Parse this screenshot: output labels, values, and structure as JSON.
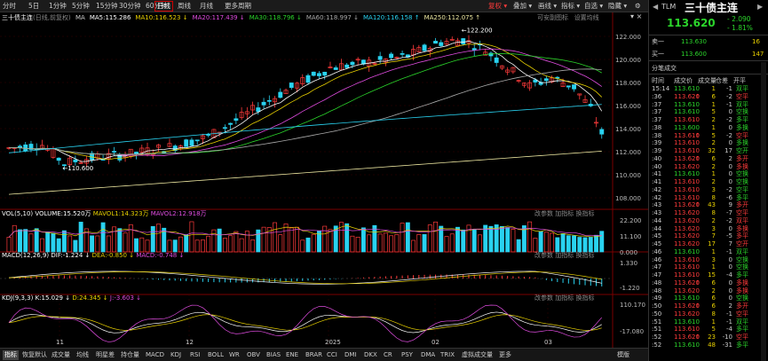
{
  "toolbar": {
    "left": [
      "分时",
      "5日",
      "1分钟",
      "5分钟",
      "15分钟",
      "30分钟",
      "60分钟",
      "日线",
      "周线",
      "月线",
      "更多周期"
    ],
    "active_index": 7,
    "right": [
      {
        "label": "复权",
        "active": true
      },
      {
        "label": "叠加"
      },
      {
        "label": "画线"
      },
      {
        "label": "指标"
      },
      {
        "label": "自选"
      },
      {
        "label": "隐藏"
      }
    ]
  },
  "main": {
    "title": "三十债主连",
    "subtitle": "(日线,前复权)",
    "ma_legend": [
      {
        "label": "MA",
        "color": "#cccccc"
      },
      {
        "label": "MA5:115.286",
        "color": "#ffffff"
      },
      {
        "label": "MA10:116.523 ↓",
        "color": "#e8d000"
      },
      {
        "label": "MA20:117.439 ↓",
        "color": "#e04ce0"
      },
      {
        "label": "MA30:118.796 ↓",
        "color": "#2bd52b"
      },
      {
        "label": "MA60:118.997 ↓",
        "color": "#aaaaaa"
      },
      {
        "label": "MA120:116.158 ↑",
        "color": "#29d2f0"
      },
      {
        "label": "MA250:112.075 ↑",
        "color": "#ece6a0"
      }
    ],
    "right_links": [
      "可安副图标",
      "设置均线"
    ],
    "max_label": "122.200",
    "min_label": "110.600",
    "yticks": [
      "122.000",
      "120.000",
      "118.000",
      "116.000",
      "114.000",
      "112.000",
      "110.000",
      "108.000"
    ]
  },
  "vol": {
    "title": "VOL(5,10)",
    "main": "VOLUME:15.520万",
    "ma1": "MAVOL1:14.323万",
    "ma2": "MAVOL2:12.918万",
    "yticks": [
      "22.200",
      "11.100",
      "0.000"
    ]
  },
  "macd": {
    "title": "MACD(12,26,9)",
    "dif": "DIF:-1.224 ↓",
    "dea": "DEA:-0.850 ↓",
    "macd": "MACD:-0.748 ↓",
    "yticks": [
      "1.330",
      "-1.220"
    ]
  },
  "kdj": {
    "title": "KDJ(9,3,3)",
    "k": "K:15.029 ↓",
    "d": "D:24.345 ↓",
    "j": "J:-3.603 ↓",
    "yticks": [
      "110.170",
      "-17.080"
    ]
  },
  "subpanel_links": [
    "改参数",
    "加指标",
    "换指标"
  ],
  "dates": [
    "11",
    "12",
    "2025",
    "02",
    "03"
  ],
  "bottom_tabs": [
    "指标",
    "恢复默认",
    "成交量",
    "均线",
    "明星差",
    "持仓量",
    "MACD",
    "KDJ",
    "RSI",
    "BOLL",
    "WR",
    "OBV",
    "BIAS",
    "ENE",
    "BRAR",
    "CCI",
    "DMI",
    "DKX",
    "CR",
    "PSY",
    "DMA",
    "TRIX",
    "虚拟成交量",
    "更多"
  ],
  "bottom_active": 0,
  "bottom_right": "模版",
  "quote": {
    "code": "TLM",
    "name": "三十债主连",
    "price": "113.620",
    "change": "- 2.090",
    "pct": "- 1.81%",
    "sell_label": "卖一",
    "sell_price": "113.630",
    "sell_vol": "16",
    "buy_label": "买一",
    "buy_price": "113.600",
    "buy_vol": "147"
  },
  "trades_title": "分笔成交",
  "trades_header": [
    "时间",
    "成交价",
    "成交量",
    "仓差",
    "开平"
  ],
  "trades": [
    {
      "t": "15:14",
      "p": "113.610",
      "pc": "g",
      "v": "1",
      "d": "-1",
      "k": "双平",
      "kc": "g"
    },
    {
      "t": ":36",
      "p": "113.620",
      "pc": "r",
      "v": "6",
      "d": "-2",
      "k": "空平",
      "kc": "r"
    },
    {
      "t": ":37",
      "p": "113.610",
      "pc": "g",
      "v": "1",
      "d": "-1",
      "k": "双平",
      "kc": "g"
    },
    {
      "t": ":37",
      "p": "113.610",
      "pc": "g",
      "v": "5",
      "d": "0",
      "k": "空换",
      "kc": "g"
    },
    {
      "t": ":37",
      "p": "113.610",
      "pc": "w",
      "v": "2",
      "d": "-2",
      "k": "多平",
      "kc": "g"
    },
    {
      "t": ":38",
      "p": "113.600",
      "pc": "g",
      "v": "1",
      "d": "0",
      "k": "多换",
      "kc": "g"
    },
    {
      "t": ":38",
      "p": "113.610",
      "pc": "r",
      "v": "5",
      "d": "-2",
      "k": "空平",
      "kc": "r"
    },
    {
      "t": ":39",
      "p": "113.610",
      "pc": "w",
      "v": "2",
      "d": "0",
      "k": "多换",
      "kc": "g"
    },
    {
      "t": ":39",
      "p": "113.610",
      "pc": "w",
      "v": "32",
      "d": "17",
      "k": "空开",
      "kc": "g"
    },
    {
      "t": ":40",
      "p": "113.620",
      "pc": "r",
      "v": "6",
      "d": "2",
      "k": "多开",
      "kc": "r"
    },
    {
      "t": ":40",
      "p": "113.620",
      "pc": "w",
      "v": "2",
      "d": "0",
      "k": "多换",
      "kc": "r"
    },
    {
      "t": ":41",
      "p": "113.610",
      "pc": "g",
      "v": "1",
      "d": "0",
      "k": "空换",
      "kc": "g"
    },
    {
      "t": ":41",
      "p": "113.610",
      "pc": "w",
      "v": "2",
      "d": "0",
      "k": "空换",
      "kc": "g"
    },
    {
      "t": ":42",
      "p": "113.610",
      "pc": "w",
      "v": "3",
      "d": "-2",
      "k": "空平",
      "kc": "g"
    },
    {
      "t": ":42",
      "p": "113.610",
      "pc": "w",
      "v": "8",
      "d": "-6",
      "k": "多平",
      "kc": "g"
    },
    {
      "t": ":43",
      "p": "113.620",
      "pc": "r",
      "v": "43",
      "d": "9",
      "k": "多开",
      "kc": "r"
    },
    {
      "t": ":43",
      "p": "113.620",
      "pc": "w",
      "v": "8",
      "d": "-7",
      "k": "空平",
      "kc": "r"
    },
    {
      "t": ":44",
      "p": "113.620",
      "pc": "w",
      "v": "2",
      "d": "-2",
      "k": "双平",
      "kc": "r"
    },
    {
      "t": ":44",
      "p": "113.620",
      "pc": "w",
      "v": "3",
      "d": "0",
      "k": "多换",
      "kc": "r"
    },
    {
      "t": ":45",
      "p": "113.620",
      "pc": "w",
      "v": "7",
      "d": "-5",
      "k": "多平",
      "kc": "r"
    },
    {
      "t": ":45",
      "p": "113.620",
      "pc": "w",
      "v": "17",
      "d": "7",
      "k": "空开",
      "kc": "r"
    },
    {
      "t": ":46",
      "p": "113.610",
      "pc": "g",
      "v": "1",
      "d": "-1",
      "k": "双平",
      "kc": "g"
    },
    {
      "t": ":46",
      "p": "113.610",
      "pc": "w",
      "v": "3",
      "d": "0",
      "k": "空换",
      "kc": "g"
    },
    {
      "t": ":47",
      "p": "113.610",
      "pc": "w",
      "v": "1",
      "d": "0",
      "k": "空换",
      "kc": "g"
    },
    {
      "t": ":47",
      "p": "113.610",
      "pc": "w",
      "v": "15",
      "d": "-4",
      "k": "多平",
      "kc": "g"
    },
    {
      "t": ":48",
      "p": "113.620",
      "pc": "r",
      "v": "6",
      "d": "0",
      "k": "多换",
      "kc": "r"
    },
    {
      "t": ":48",
      "p": "113.620",
      "pc": "w",
      "v": "2",
      "d": "0",
      "k": "多换",
      "kc": "r"
    },
    {
      "t": ":49",
      "p": "113.610",
      "pc": "g",
      "v": "6",
      "d": "0",
      "k": "空换",
      "kc": "g"
    },
    {
      "t": ":50",
      "p": "113.620",
      "pc": "r",
      "v": "6",
      "d": "2",
      "k": "多开",
      "kc": "r"
    },
    {
      "t": ":50",
      "p": "113.620",
      "pc": "w",
      "v": "8",
      "d": "-1",
      "k": "空平",
      "kc": "r"
    },
    {
      "t": ":51",
      "p": "113.610",
      "pc": "g",
      "v": "1",
      "d": "-1",
      "k": "双平",
      "kc": "g"
    },
    {
      "t": ":51",
      "p": "113.610",
      "pc": "w",
      "v": "5",
      "d": "-4",
      "k": "多平",
      "kc": "g"
    },
    {
      "t": ":52",
      "p": "113.620",
      "pc": "r",
      "v": "23",
      "d": "-10",
      "k": "空平",
      "kc": "r"
    },
    {
      "t": ":52",
      "p": "113.610",
      "pc": "g",
      "v": "48",
      "d": "-31",
      "k": "多平",
      "kc": "g"
    }
  ],
  "colors": {
    "up": "#ff3b3b",
    "down": "#29d2f0",
    "bg": "#000000",
    "grid": "#3a0000"
  }
}
